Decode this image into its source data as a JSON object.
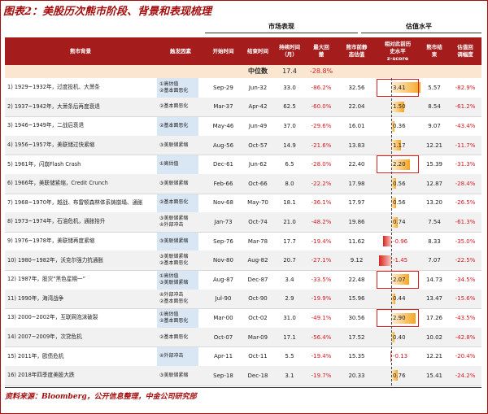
{
  "title": "图表2：美股历次熊市阶段、背景和表现梳理",
  "groups": {
    "market": "市场表现",
    "valuation": "估值水平"
  },
  "headers": {
    "bear": "熊市背景",
    "trigger": "触发因素",
    "start": "开始时间",
    "end": "结束时间",
    "duration": "持续时间（月）",
    "maxdd": "最大回撤",
    "pe_before": "熊市前静态估值",
    "z_line1": "相对此前历史水平",
    "z_line2": "z-score",
    "pe_end": "熊市结束",
    "val_change": "估值回调幅度"
  },
  "median": {
    "label": "中位数",
    "duration": "17.4",
    "maxdd": "-28.8%"
  },
  "rows": [
    {
      "name": "1) 1929~1932年，过度投机、大萧条",
      "trig": [
        "①高估值",
        "②基本面恶化"
      ],
      "start": "Sep-29",
      "end": "Jun-32",
      "dur": "33.0",
      "dd": "-86.2%",
      "pe": "32.56",
      "z": "3.41",
      "zv": 3.41,
      "pe2": "5.57",
      "vc": "-82.9%"
    },
    {
      "name": "2) 1937~1942年，大萧条后再度衰退",
      "trig": [
        "②基本面恶化"
      ],
      "start": "Mar-37",
      "end": "Apr-42",
      "dur": "62.5",
      "dd": "-60.0%",
      "pe": "22.04",
      "z": "1.50",
      "zv": 1.5,
      "pe2": "8.54",
      "vc": "-61.2%"
    },
    {
      "name": "3) 1946~1949年，二战后衰退",
      "trig": [
        "②基本面恶化"
      ],
      "start": "May-46",
      "end": "Jun-49",
      "dur": "37.0",
      "dd": "-29.6%",
      "pe": "16.01",
      "z": "0.36",
      "zv": 0.36,
      "pe2": "9.07",
      "vc": "-43.4%"
    },
    {
      "name": "4) 1956~1957年，美联储过快紧缩",
      "trig": [
        "③美联储紧缩"
      ],
      "start": "Aug-56",
      "end": "Oct-57",
      "dur": "14.9",
      "dd": "-21.6%",
      "pe": "13.83",
      "z": "1.17",
      "zv": 1.17,
      "pe2": "12.21",
      "vc": "-11.7%"
    },
    {
      "name": "5) 1961年，闪崩Flash Crash",
      "trig": [
        "①高估值"
      ],
      "start": "Dec-61",
      "end": "Jun-62",
      "dur": "6.5",
      "dd": "-28.0%",
      "pe": "22.40",
      "z": "2.20",
      "zv": 2.2,
      "pe2": "15.39",
      "vc": "-31.3%"
    },
    {
      "name": "6) 1966年，美联储紧缩，Credit Crunch",
      "trig": [
        "③美联储紧缩"
      ],
      "start": "Feb-66",
      "end": "Oct-66",
      "dur": "8.0",
      "dd": "-22.2%",
      "pe": "17.98",
      "z": "0.56",
      "zv": 0.56,
      "pe2": "12.87",
      "vc": "-28.4%"
    },
    {
      "name": "7) 1968~1970年，越战、布雷顿森林体系铸崩塌、通胀",
      "trig": [
        "②基本面恶化"
      ],
      "start": "Nov-68",
      "end": "May-70",
      "dur": "18.1",
      "dd": "-36.1%",
      "pe": "17.97",
      "z": "0.56",
      "zv": 0.56,
      "pe2": "13.20",
      "vc": "-26.5%"
    },
    {
      "name": "8) 1973~1974年，石油危机，通胀抬升",
      "trig": [
        "③美联储紧缩",
        "④外部冲击"
      ],
      "start": "Jan-73",
      "end": "Oct-74",
      "dur": "21.0",
      "dd": "-48.2%",
      "pe": "19.86",
      "z": "0.74",
      "zv": 0.74,
      "pe2": "7.54",
      "vc": "-61.3%"
    },
    {
      "name": "9) 1976~1978年，美联储再度紧缩",
      "trig": [
        "③美联储紧缩"
      ],
      "start": "Sep-76",
      "end": "Mar-78",
      "dur": "17.7",
      "dd": "-19.4%",
      "pe": "11.62",
      "z": "-0.96",
      "zv": -0.96,
      "pe2": "8.33",
      "vc": "-35.0%"
    },
    {
      "name": "10) 1980~1982年，沃克尔强力抗通胀",
      "trig": [
        "③美联储紧缩",
        "②基本面恶化"
      ],
      "start": "Nov-80",
      "end": "Aug-82",
      "dur": "20.7",
      "dd": "-27.1%",
      "pe": "9.12",
      "z": "-1.45",
      "zv": -1.45,
      "pe2": "7.07",
      "vc": "-22.5%"
    },
    {
      "name": "12) 1987年，股灾“黑色星期一”",
      "trig": [
        "①高估值",
        "③美联储紧缩"
      ],
      "start": "Aug-87",
      "end": "Dec-87",
      "dur": "3.4",
      "dd": "-33.5%",
      "pe": "22.48",
      "z": "2.07",
      "zv": 2.07,
      "pe2": "14.73",
      "vc": "-34.5%"
    },
    {
      "name": "11) 1990年，海湾战争",
      "trig": [
        "④外部冲击",
        "②基本面恶化"
      ],
      "start": "Jul-90",
      "end": "Oct-90",
      "dur": "2.9",
      "dd": "-19.9%",
      "pe": "15.96",
      "z": "0.44",
      "zv": 0.44,
      "pe2": "13.47",
      "vc": "-15.6%"
    },
    {
      "name": "13) 2000~2002年，互联网泡沫破裂",
      "trig": [
        "①高估值",
        "②基本面恶化"
      ],
      "start": "Mar-00",
      "end": "Oct-02",
      "dur": "31.0",
      "dd": "-49.1%",
      "pe": "30.56",
      "z": "2.90",
      "zv": 2.9,
      "pe2": "17.26",
      "vc": "-43.5%"
    },
    {
      "name": "14) 2007~2009年，次贷危机",
      "trig": [
        "②基本面恶化"
      ],
      "start": "Oct-07",
      "end": "Mar-09",
      "dur": "17.1",
      "dd": "-56.4%",
      "pe": "17.52",
      "z": "0.40",
      "zv": 0.4,
      "pe2": "10.02",
      "vc": "-42.8%"
    },
    {
      "name": "15) 2011年，欧债危机",
      "trig": [
        "④外部冲击"
      ],
      "start": "Apr-11",
      "end": "Oct-11",
      "dur": "5.5",
      "dd": "-19.4%",
      "pe": "15.35",
      "z": "-0.13",
      "zv": -0.13,
      "pe2": "12.21",
      "vc": "-20.4%"
    },
    {
      "name": "16) 2018年四季度美股大跌",
      "trig": [
        "③美联储紧缩"
      ],
      "start": "Sep-18",
      "end": "Dec-18",
      "dur": "3.1",
      "dd": "-19.7%",
      "pe": "20.33",
      "z": "0.76",
      "zv": 0.76,
      "pe2": "15.41",
      "vc": "-24.2%"
    }
  ],
  "highlighted_rows": [
    0,
    4,
    10,
    12
  ],
  "colors": {
    "accent": "#a51c1c",
    "negative": "#d71920",
    "bar_positive": "#f5a623",
    "bar_negative": "#d9241b",
    "highlight": "#e0201d"
  },
  "footer": "资料来源：Bloomberg，公开信息整理，中金公司研究部"
}
